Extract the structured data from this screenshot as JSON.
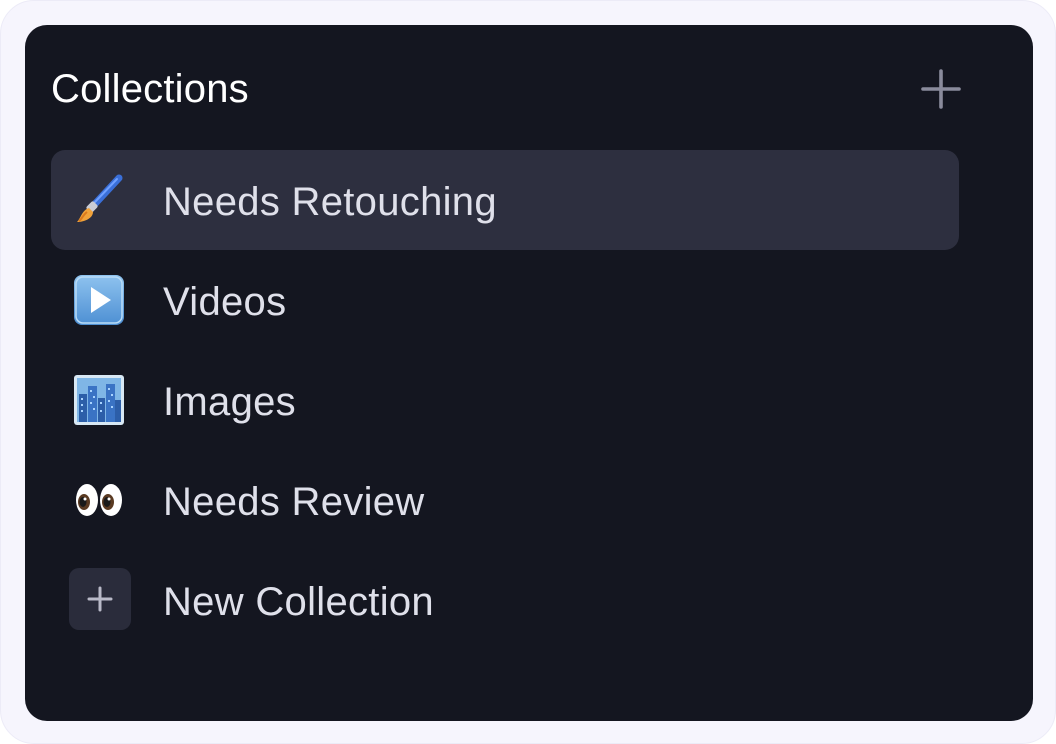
{
  "panel": {
    "title": "Collections",
    "add_icon": "plus-icon"
  },
  "collections": [
    {
      "label": "Needs Retouching",
      "icon": "paintbrush-icon",
      "selected": true
    },
    {
      "label": "Videos",
      "icon": "play-button-icon",
      "selected": false
    },
    {
      "label": "Images",
      "icon": "cityscape-icon",
      "selected": false
    },
    {
      "label": "Needs Review",
      "icon": "eyes-icon",
      "selected": false
    }
  ],
  "new_collection": {
    "label": "New Collection",
    "icon": "plus-icon"
  },
  "colors": {
    "panel_bg": "#141620",
    "selected_bg": "#2d2f3f",
    "text": "#dfe0ea",
    "title": "#ffffff",
    "muted_icon": "#8a8b9c"
  }
}
